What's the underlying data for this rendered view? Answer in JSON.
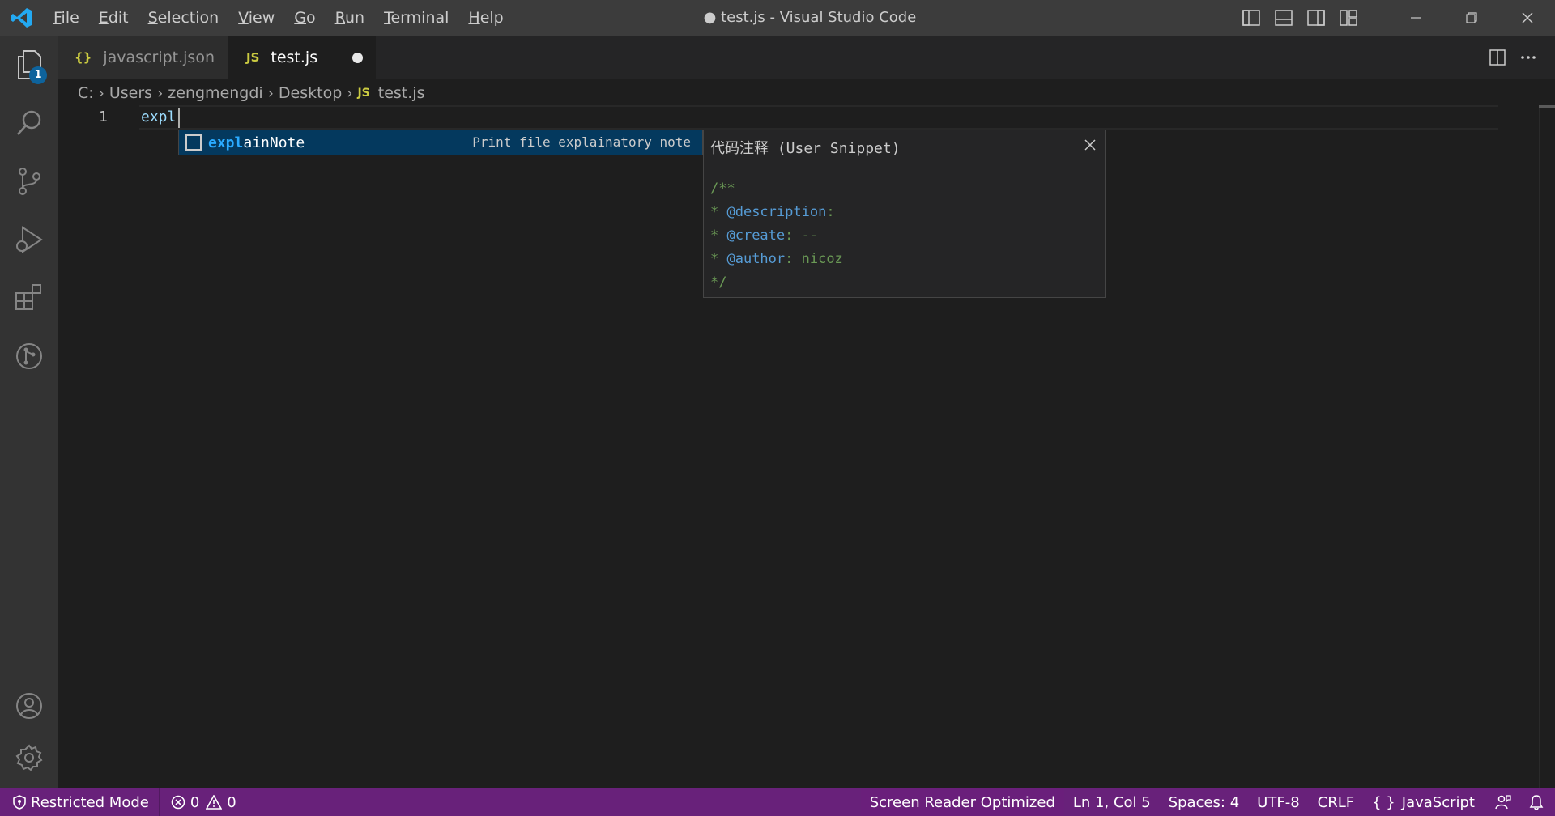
{
  "window": {
    "title": "● test.js - Visual Studio Code",
    "logo_icon": "vscode-logo-icon"
  },
  "menu": {
    "items": [
      {
        "mnemonic": "F",
        "rest": "ile"
      },
      {
        "mnemonic": "E",
        "rest": "dit"
      },
      {
        "mnemonic": "S",
        "rest": "election"
      },
      {
        "mnemonic": "V",
        "rest": "iew"
      },
      {
        "mnemonic": "G",
        "rest": "o"
      },
      {
        "mnemonic": "R",
        "rest": "un"
      },
      {
        "mnemonic": "T",
        "rest": "erminal"
      },
      {
        "mnemonic": "H",
        "rest": "elp"
      }
    ]
  },
  "activity_bar": {
    "explorer_badge": "1",
    "items": [
      "explorer-icon",
      "search-icon",
      "source-control-icon",
      "run-debug-icon",
      "extensions-icon",
      "git-graph-icon",
      "accounts-icon",
      "manage-gear-icon"
    ]
  },
  "tabs": [
    {
      "label": "javascript.json",
      "icon": "{}",
      "active": false
    },
    {
      "label": "test.js",
      "icon": "JS",
      "active": true,
      "dirty": true
    }
  ],
  "breadcrumbs": {
    "parts": [
      "C:",
      "Users",
      "zengmengdi",
      "Desktop"
    ],
    "file_icon": "JS",
    "file": "test.js"
  },
  "editor": {
    "line_number": "1",
    "code": "expl"
  },
  "suggest": {
    "match": "expl",
    "rest": "ainNote",
    "detail": "Print file explainatory note"
  },
  "details": {
    "title": "代码注释 (User Snippet)",
    "line1": "/**",
    "line2_prefix": "* ",
    "line2_tag": "@description",
    "line2_rest": ":",
    "line3_prefix": "* ",
    "line3_tag": "@create",
    "line3_rest": ": --",
    "line4_prefix": "* ",
    "line4_tag": "@author",
    "line4_rest": ": nicoz",
    "line5": "*/"
  },
  "status_bar": {
    "restricted": "Restricted Mode",
    "errors": "0",
    "warnings": "0",
    "screen_reader": "Screen Reader Optimized",
    "position": "Ln 1, Col 5",
    "spaces": "Spaces: 4",
    "encoding": "UTF-8",
    "eol": "CRLF",
    "language_icon": "{ }",
    "language": "JavaScript"
  },
  "colors": {
    "statusbar": "#68217a",
    "accent": "#0e639c",
    "suggest_highlight": "#2aaaff"
  }
}
